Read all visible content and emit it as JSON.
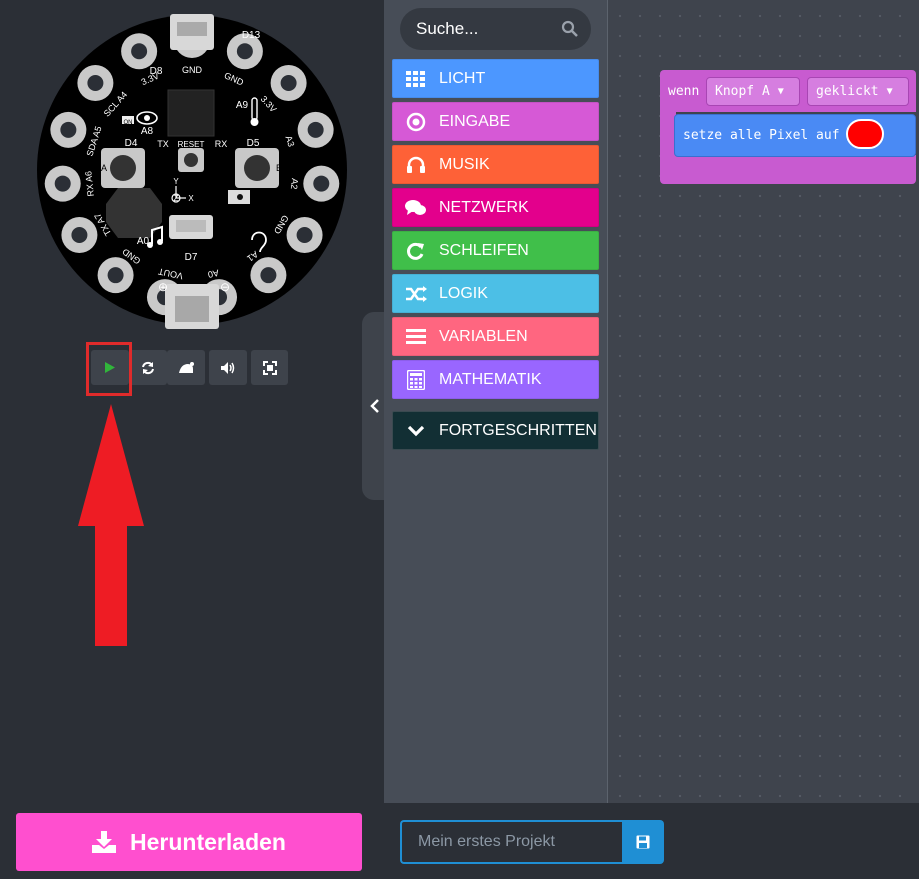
{
  "search": {
    "placeholder": "Suche..."
  },
  "categories": [
    {
      "label": "LICHT",
      "color": "#4c97ff",
      "icon": "grid-icon"
    },
    {
      "label": "EINGABE",
      "color": "#d659d6",
      "icon": "target-icon"
    },
    {
      "label": "MUSIK",
      "color": "#fe6137",
      "icon": "headphones-icon"
    },
    {
      "label": "NETZWERK",
      "color": "#e3008c",
      "icon": "chat-icon"
    },
    {
      "label": "SCHLEIFEN",
      "color": "#40bf4a",
      "icon": "refresh-icon"
    },
    {
      "label": "LOGIK",
      "color": "#4cbfe6",
      "icon": "shuffle-icon"
    },
    {
      "label": "VARIABLEN",
      "color": "#ff6680",
      "icon": "list-icon"
    },
    {
      "label": "MATHEMATIK",
      "color": "#9966ff",
      "icon": "calculator-icon"
    },
    {
      "label": "FORTGESCHRITTEN",
      "color": "#122f34",
      "icon": "chevron-down-icon"
    }
  ],
  "blocks": {
    "event_label": "wenn",
    "button_value": "Knopf A",
    "action_value": "geklickt",
    "statement_label": "setze alle Pixel auf",
    "pixel_color": "#ff0000"
  },
  "board": {
    "pads": [
      "GND",
      "3.3V",
      "A3",
      "A2",
      "GND",
      "A1",
      "A0",
      "VOUT",
      "GND",
      "A7",
      "A6",
      "A5",
      "A4",
      "3.3V",
      "GND"
    ],
    "pad_aliases": {
      "A7": "TX",
      "A6": "RX",
      "A5": "SDA",
      "A4": "SCL",
      "A3": ""
    },
    "labels": {
      "d13": "D13",
      "d8": "D8",
      "d4": "D4",
      "d5": "D5",
      "d7": "D7",
      "a8": "A8",
      "a9": "A9",
      "a0": "A0",
      "tx": "TX",
      "rx": "RX",
      "reset": "RESET",
      "btn_a": "A",
      "btn_b": "B",
      "on": "ON",
      "y": "Y",
      "z": "Z",
      "x": "X"
    }
  },
  "sim_controls": {
    "buttons": [
      "play-icon",
      "restart-icon",
      "slowmo-icon",
      "sound-icon",
      "fullscreen-icon"
    ]
  },
  "download": {
    "label": "Herunterladen"
  },
  "project": {
    "placeholder": "Mein erstes Projekt"
  },
  "colors": {
    "accent_red": "#e02b2b",
    "download": "#ff4fcf",
    "save": "#1f8fd4"
  }
}
